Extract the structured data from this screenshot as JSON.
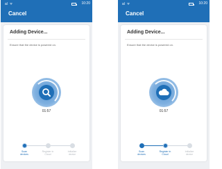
{
  "screens": [
    {
      "status": {
        "signal": "al ᯤ",
        "time": "10:20"
      },
      "header": {
        "cancel_label": "Cancel"
      },
      "card": {
        "title": "Adding Device...",
        "hint": "Ensure that the device is powered on.",
        "center_icon": "search-icon",
        "timer": "01:57"
      },
      "steps": [
        {
          "label_line1": "Scan",
          "label_line2": "devices",
          "state": "active"
        },
        {
          "label_line1": "Register in",
          "label_line2": "Cloud",
          "state": "pending"
        },
        {
          "label_line1": "Initialize",
          "label_line2": "device",
          "state": "pending"
        }
      ]
    },
    {
      "status": {
        "signal": "al ᯤ",
        "time": "10:20"
      },
      "header": {
        "cancel_label": "Cancel"
      },
      "card": {
        "title": "Adding Device...",
        "hint": "Ensure that the device is powered on.",
        "center_icon": "cloud-icon",
        "timer": "01:57"
      },
      "steps": [
        {
          "label_line1": "Scan",
          "label_line2": "devices",
          "state": "done"
        },
        {
          "label_line1": "Register in",
          "label_line2": "Cloud",
          "state": "active"
        },
        {
          "label_line1": "Initialize",
          "label_line2": "device",
          "state": "pending"
        }
      ]
    }
  ],
  "colors": {
    "brand": "#1f6fb7",
    "inactive": "#d9dee4",
    "background": "#eef0f3"
  }
}
